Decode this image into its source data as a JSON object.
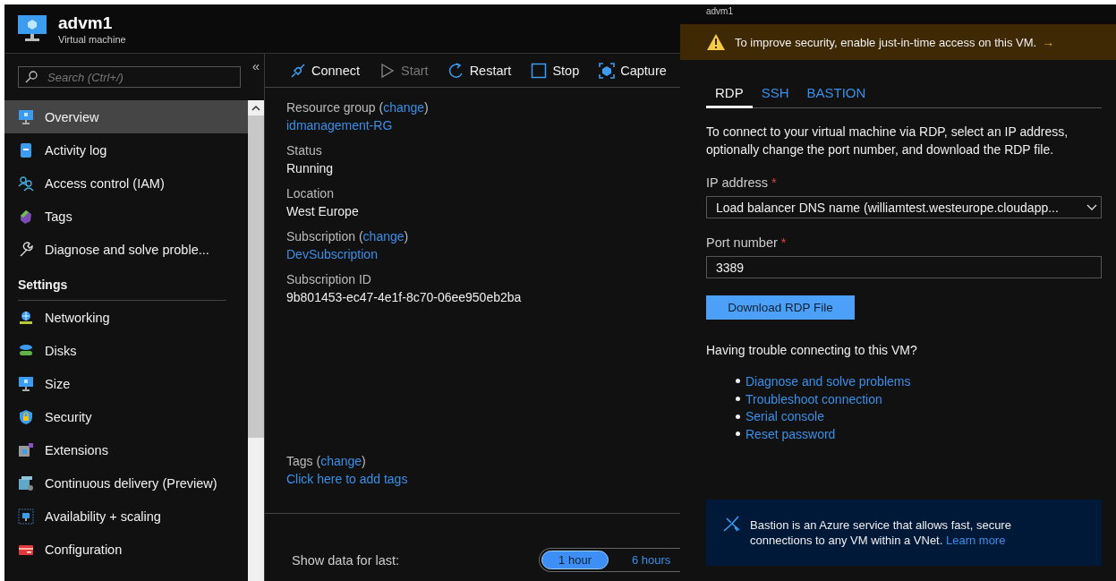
{
  "resource": {
    "title": "advm1",
    "subtitle": "Virtual machine"
  },
  "sidebar": {
    "search_placeholder": "Search (Ctrl+/)",
    "collapse": "«",
    "items": [
      {
        "label": "Overview",
        "selected": true
      },
      {
        "label": "Activity log",
        "selected": false
      },
      {
        "label": "Access control (IAM)",
        "selected": false
      },
      {
        "label": "Tags",
        "selected": false
      },
      {
        "label": "Diagnose and solve proble...",
        "selected": false
      }
    ],
    "sections": [
      {
        "heading": "Settings",
        "items": [
          {
            "label": "Networking",
            "selected": false
          },
          {
            "label": "Disks",
            "selected": false
          },
          {
            "label": "Size",
            "selected": false
          },
          {
            "label": "Security",
            "selected": false
          },
          {
            "label": "Extensions",
            "selected": false
          },
          {
            "label": "Continuous delivery (Preview)",
            "selected": false
          },
          {
            "label": "Availability + scaling",
            "selected": false
          },
          {
            "label": "Configuration",
            "selected": false
          }
        ]
      }
    ]
  },
  "toolbar": [
    {
      "label": "Connect",
      "disabled": false
    },
    {
      "label": "Start",
      "disabled": true
    },
    {
      "label": "Restart",
      "disabled": false
    },
    {
      "label": "Stop",
      "disabled": false
    },
    {
      "label": "Capture",
      "disabled": false
    }
  ],
  "properties": [
    {
      "label": "Resource group (",
      "link": "change",
      "after": ")",
      "value": "idmanagement-RG",
      "kind": "link"
    },
    {
      "label": "Status",
      "value": "Running",
      "kind": "text"
    },
    {
      "label": "Location",
      "value": "West Europe",
      "kind": "text"
    },
    {
      "label": "Subscription (",
      "link": "change",
      "after": ")",
      "value": "DevSubscription",
      "kind": "link"
    },
    {
      "label": "Subscription ID",
      "value": "9b801453-ec47-4e1f-8c70-06ee950eb2ba",
      "kind": "text"
    }
  ],
  "tags": {
    "label": "Tags (",
    "link": "change",
    "after": ")",
    "value": "Click here to add tags"
  },
  "time_range": {
    "label": "Show data for last:",
    "options": [
      {
        "label": "1 hour",
        "selected": true
      },
      {
        "label": "6 hours",
        "selected": false
      }
    ]
  },
  "connect_panel": {
    "title": "advm1",
    "banner": {
      "text": "To improve security, enable just-in-time access on this VM.",
      "arrow": "→"
    },
    "tabs": [
      {
        "label": "RDP",
        "selected": true
      },
      {
        "label": "SSH",
        "selected": false
      },
      {
        "label": "BASTION",
        "selected": false
      }
    ],
    "description": "To connect to your virtual machine via RDP, select an IP address, optionally change the port number, and download the RDP file.",
    "ip_field": {
      "label": "IP address",
      "required_mark": "*",
      "value": "Load balancer DNS name (williamtest.westeurope.cloudapp..."
    },
    "port_field": {
      "label": "Port number",
      "required_mark": "*",
      "value": "3389"
    },
    "download_button": "Download RDP File",
    "trouble_heading": "Having trouble connecting to this VM?",
    "trouble_links": [
      "Diagnose and solve problems",
      "Troubleshoot connection",
      "Serial console",
      "Reset password"
    ],
    "bastion_note": {
      "text": "Bastion is an Azure service that allows fast, secure connections to any VM within a VNet.",
      "link": "Learn more"
    }
  }
}
